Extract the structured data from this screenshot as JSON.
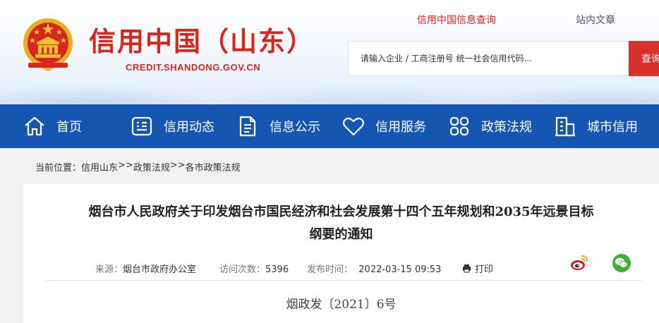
{
  "header": {
    "site_title": "信用中国（山东）",
    "site_domain": "CREDIT.SHANDONG.GOV.CN",
    "tabs": [
      {
        "label": "信用中国信息查询",
        "active": true
      },
      {
        "label": "站内文章",
        "active": false
      }
    ],
    "search": {
      "placeholder": "请输入企业 / 工商注册号 统一社会信用代码...",
      "button_label": "查询"
    },
    "brand_red": "#d7261e"
  },
  "nav": {
    "color": "#1656b3",
    "items": [
      {
        "label": "首页",
        "icon": "home-icon"
      },
      {
        "label": "信用动态",
        "icon": "news-icon"
      },
      {
        "label": "信息公示",
        "icon": "document-icon"
      },
      {
        "label": "信用服务",
        "icon": "heart-icon"
      },
      {
        "label": "政策法规",
        "icon": "grid-icon"
      },
      {
        "label": "城市信用",
        "icon": "building-icon"
      }
    ]
  },
  "breadcrumb": {
    "prefix": "当前位置：",
    "items": [
      "信用山东",
      ">>",
      "政策法规",
      ">>",
      "各市政策法规"
    ]
  },
  "article": {
    "title_line1": "烟台市人民政府关于印发烟台市国民经济和社会发展第十四个五年规划和2035年远景目标",
    "title_line2": "纲要的通知",
    "source_label": "来源：",
    "source": "烟台市政府办公室",
    "visits_label": "访问次数：",
    "visits": "5396",
    "published_label": "发布时间：",
    "published": "2022-03-15 09:53",
    "print_label": "打印",
    "share_icons": [
      "weibo-icon",
      "wechat-icon"
    ],
    "doc_number": "烟政发〔2021〕6号"
  }
}
